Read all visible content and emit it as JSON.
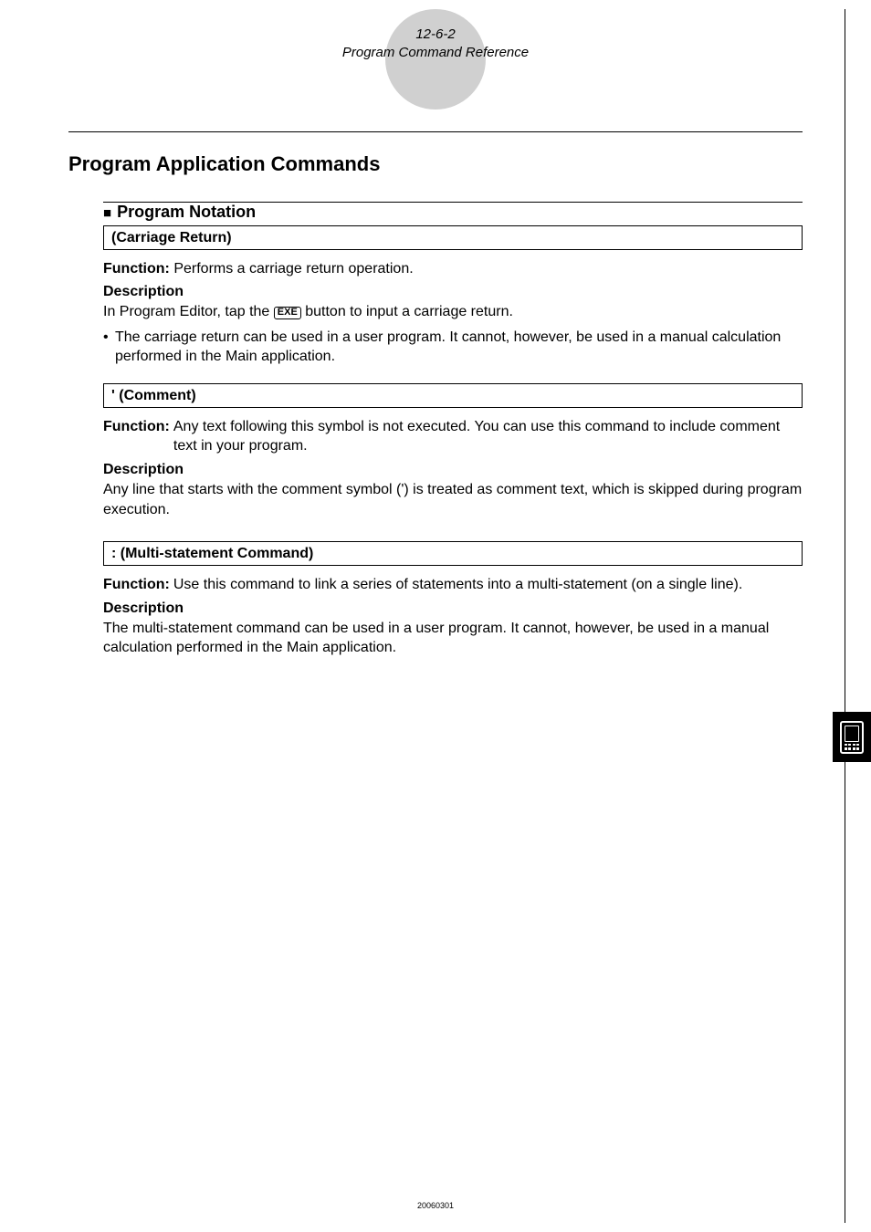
{
  "header": {
    "pageRef": "12-6-2",
    "title": "Program Command Reference"
  },
  "main": {
    "heading": "Program Application Commands",
    "section_heading": "Program Notation",
    "cmd1": {
      "title": "(Carriage Return)",
      "func_label": "Function:",
      "func_text": " Performs a carriage return operation.",
      "desc_label": "Description",
      "line1a": "In Program Editor, tap the ",
      "exe": "EXE",
      "line1b": " button to input a carriage return.",
      "bullet_text": "The carriage return can be used in a user program. It cannot, however, be used in a manual calculation performed in the Main application."
    },
    "cmd2": {
      "title": "' (Comment)",
      "func_label": "Function:",
      "func_text": " Any text following this symbol is not executed. You can use this command to include comment text in your program.",
      "desc_label": "Description",
      "desc_text": "Any line that starts with the comment symbol (') is treated as comment text, which is skipped during program execution."
    },
    "cmd3": {
      "title": ": (Multi-statement Command)",
      "func_label": "Function:",
      "func_text": " Use this command to link a series of statements into a multi-statement (on a single line).",
      "desc_label": "Description",
      "desc_text": "The multi-statement command can be used in a user program. It cannot, however, be used in a manual calculation performed in the Main application."
    }
  },
  "footer": "20060301"
}
